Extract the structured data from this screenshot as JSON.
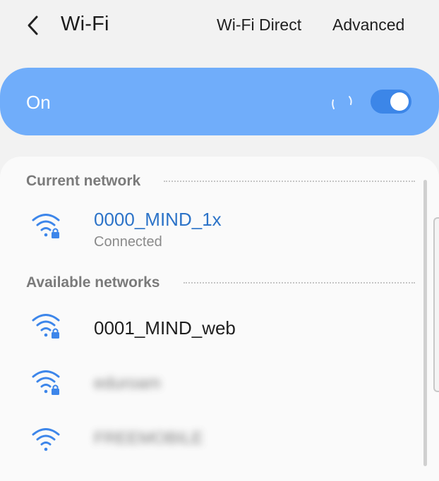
{
  "header": {
    "back_icon": "chevron-left-icon",
    "title": "Wi-Fi",
    "actions": [
      "Wi-Fi Direct",
      "Advanced"
    ]
  },
  "master_toggle": {
    "label": "On",
    "state": true,
    "colors": {
      "card": "#70adfa",
      "switch_track": "#3c86e8",
      "switch_knob": "#ffffff"
    }
  },
  "current_section": {
    "title": "Current network",
    "network": {
      "name": "0000_MIND_1x",
      "status": "Connected",
      "icon": "wifi-locked-icon",
      "color": "#2c73c8"
    }
  },
  "available_section": {
    "title": "Available networks",
    "networks": [
      {
        "name": "0001_MIND_web",
        "icon": "wifi-locked-icon",
        "blurred": false
      },
      {
        "name": "eduroam",
        "icon": "wifi-locked-icon",
        "blurred": true
      },
      {
        "name": "FREEMOBILE",
        "icon": "wifi-icon",
        "blurred": true
      }
    ]
  }
}
